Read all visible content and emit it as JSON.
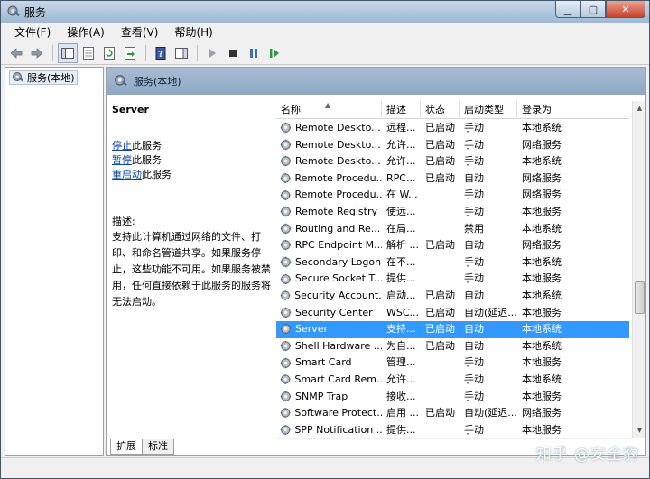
{
  "window": {
    "title": "服务",
    "minimize": "▁",
    "maximize": "▢",
    "close": "✕"
  },
  "menu": [
    {
      "label": "文件(F)"
    },
    {
      "label": "操作(A)"
    },
    {
      "label": "查看(V)"
    },
    {
      "label": "帮助(H)"
    }
  ],
  "tree": {
    "root_label": "服务(本地)"
  },
  "header": {
    "title": "服务(本地)"
  },
  "details": {
    "service_name": "Server",
    "stop_link": "停止",
    "stop_suffix": "此服务",
    "pause_link": "暂停",
    "pause_suffix": "此服务",
    "restart_link": "重启动",
    "restart_suffix": "此服务",
    "description_label": "描述:",
    "description_text": "支持此计算机通过网络的文件、打印、和命名管道共享。如果服务停止，这些功能不可用。如果服务被禁用，任何直接依赖于此服务的服务将无法启动。"
  },
  "columns": {
    "name": "名称",
    "description": "描述",
    "status": "状态",
    "startup": "启动类型",
    "logon": "登录为"
  },
  "rows": [
    {
      "name": "Remote Deskto...",
      "desc": "远程...",
      "status": "已启动",
      "startup": "手动",
      "logon": "本地系统"
    },
    {
      "name": "Remote Deskto...",
      "desc": "允许...",
      "status": "已启动",
      "startup": "手动",
      "logon": "网络服务"
    },
    {
      "name": "Remote Deskto...",
      "desc": "允许...",
      "status": "已启动",
      "startup": "手动",
      "logon": "本地系统"
    },
    {
      "name": "Remote Procedu...",
      "desc": "RPC...",
      "status": "已启动",
      "startup": "自动",
      "logon": "网络服务"
    },
    {
      "name": "Remote Procedu...",
      "desc": "在 W...",
      "status": "",
      "startup": "手动",
      "logon": "网络服务"
    },
    {
      "name": "Remote Registry",
      "desc": "使远...",
      "status": "",
      "startup": "手动",
      "logon": "本地服务"
    },
    {
      "name": "Routing and Re...",
      "desc": "在局...",
      "status": "",
      "startup": "禁用",
      "logon": "本地系统"
    },
    {
      "name": "RPC Endpoint M...",
      "desc": "解析 ...",
      "status": "已启动",
      "startup": "自动",
      "logon": "网络服务"
    },
    {
      "name": "Secondary Logon",
      "desc": "在不...",
      "status": "",
      "startup": "手动",
      "logon": "本地系统"
    },
    {
      "name": "Secure Socket T...",
      "desc": "提供...",
      "status": "",
      "startup": "手动",
      "logon": "本地服务"
    },
    {
      "name": "Security Account...",
      "desc": "启动...",
      "status": "已启动",
      "startup": "自动",
      "logon": "本地系统"
    },
    {
      "name": "Security Center",
      "desc": "WSC...",
      "status": "已启动",
      "startup": "自动(延迟...",
      "logon": "本地服务"
    },
    {
      "name": "Server",
      "desc": "支持...",
      "status": "已启动",
      "startup": "自动",
      "logon": "本地系统",
      "selected": true
    },
    {
      "name": "Shell Hardware ...",
      "desc": "为自...",
      "status": "已启动",
      "startup": "自动",
      "logon": "本地系统"
    },
    {
      "name": "Smart Card",
      "desc": "管理...",
      "status": "",
      "startup": "手动",
      "logon": "本地服务"
    },
    {
      "name": "Smart Card Rem...",
      "desc": "允许...",
      "status": "",
      "startup": "手动",
      "logon": "本地系统"
    },
    {
      "name": "SNMP Trap",
      "desc": "接收...",
      "status": "",
      "startup": "手动",
      "logon": "本地服务"
    },
    {
      "name": "Software Protect...",
      "desc": "启用 ...",
      "status": "已启动",
      "startup": "自动(延迟...",
      "logon": "网络服务"
    },
    {
      "name": "SPP Notification ...",
      "desc": "提供...",
      "status": "",
      "startup": "手动",
      "logon": "本地服务"
    }
  ],
  "tabs": [
    {
      "label": "扩展"
    },
    {
      "label": "标准"
    }
  ],
  "watermark": "知乎 @安全豹",
  "colors": {
    "selection": "#3399ff",
    "header_band": "#9fb6cf",
    "link": "#0645ad"
  }
}
